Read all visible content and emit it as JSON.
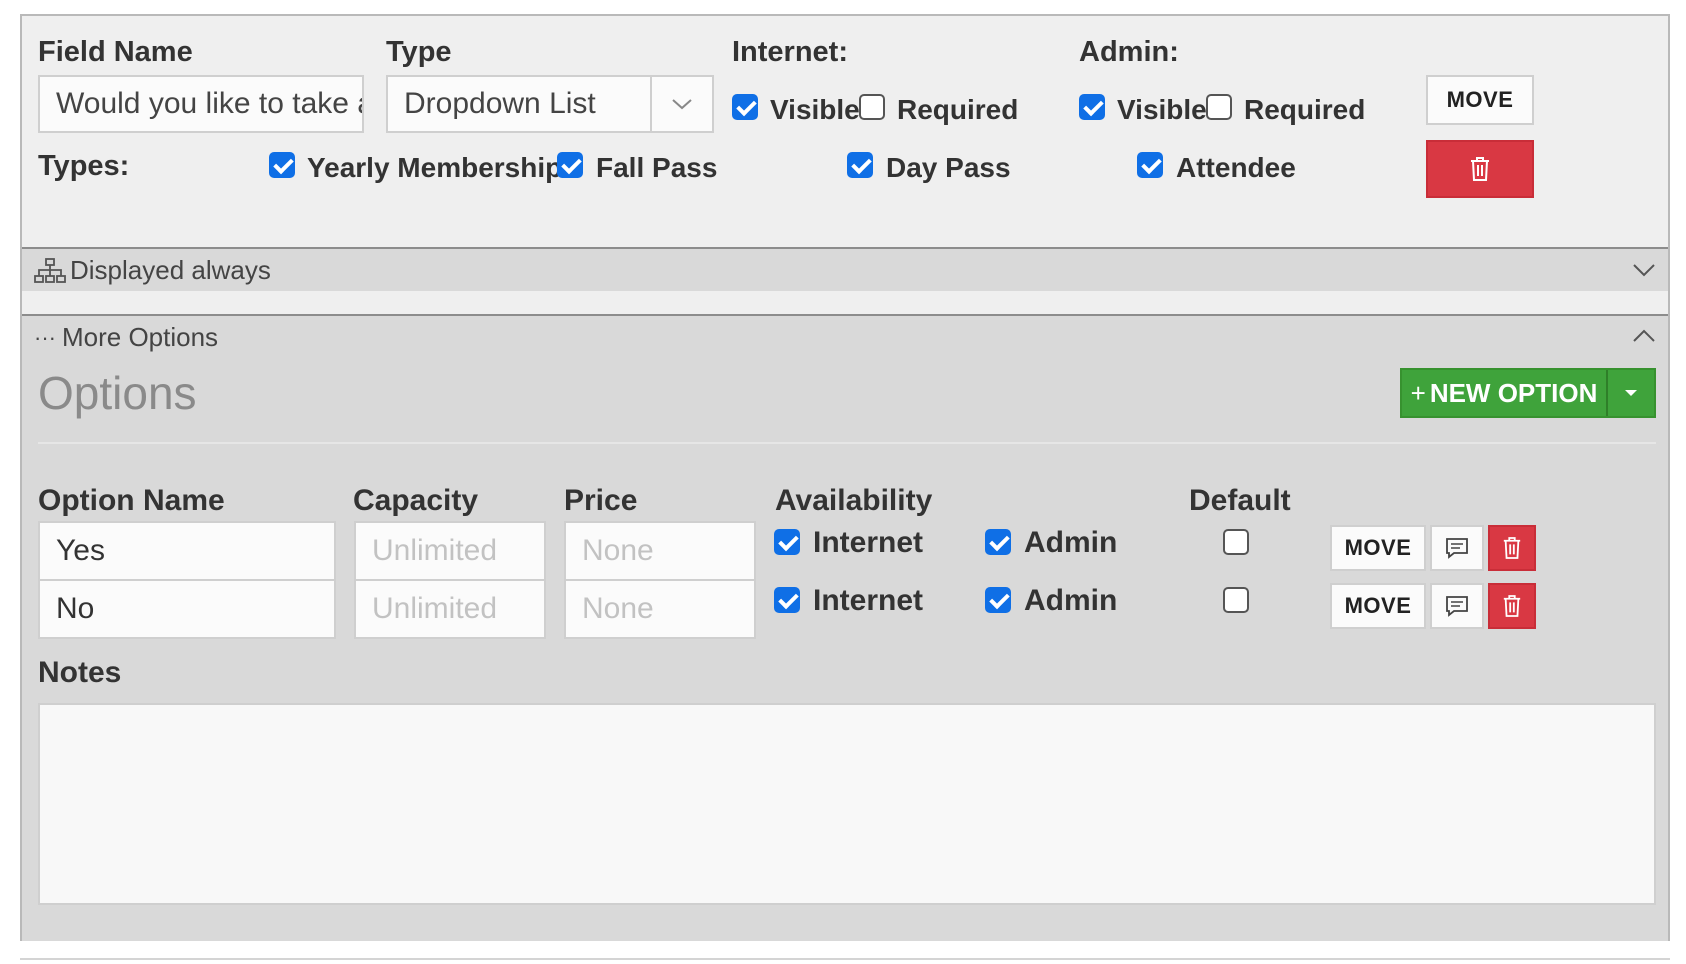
{
  "field": {
    "name_label": "Field Name",
    "name_value": "Would you like to take a",
    "type_label": "Type",
    "type_value": "Dropdown List"
  },
  "internet": {
    "label": "Internet:",
    "visible_label": "Visible",
    "visible": true,
    "required_label": "Required",
    "required": false
  },
  "admin": {
    "label": "Admin:",
    "visible_label": "Visible",
    "visible": true,
    "required_label": "Required",
    "required": false
  },
  "move_label": "MOVE",
  "types": {
    "label": "Types:",
    "items": [
      {
        "label": "Yearly Membership",
        "checked": true
      },
      {
        "label": "Fall Pass",
        "checked": true
      },
      {
        "label": "Day Pass",
        "checked": true
      },
      {
        "label": "Attendee",
        "checked": true
      }
    ]
  },
  "display_bar": {
    "label": "Displayed always"
  },
  "more_bar": {
    "label": "More Options"
  },
  "options": {
    "title": "Options",
    "new_option_label": "NEW OPTION",
    "columns": {
      "name": "Option Name",
      "capacity": "Capacity",
      "price": "Price",
      "availability": "Availability",
      "default": "Default"
    },
    "rows": [
      {
        "name": "Yes",
        "capacity_placeholder": "Unlimited",
        "price_placeholder": "None",
        "internet_label": "Internet",
        "internet": true,
        "admin_label": "Admin",
        "admin": true,
        "default": false,
        "move_label": "MOVE"
      },
      {
        "name": "No",
        "capacity_placeholder": "Unlimited",
        "price_placeholder": "None",
        "internet_label": "Internet",
        "internet": true,
        "admin_label": "Admin",
        "admin": true,
        "default": false,
        "move_label": "MOVE"
      }
    ]
  },
  "notes": {
    "label": "Notes",
    "value": ""
  },
  "colors": {
    "checkbox": "#0f6fe6",
    "danger": "#d93843",
    "success": "#3fa33b",
    "panel": "#efefef",
    "section": "#d9d9d9"
  }
}
